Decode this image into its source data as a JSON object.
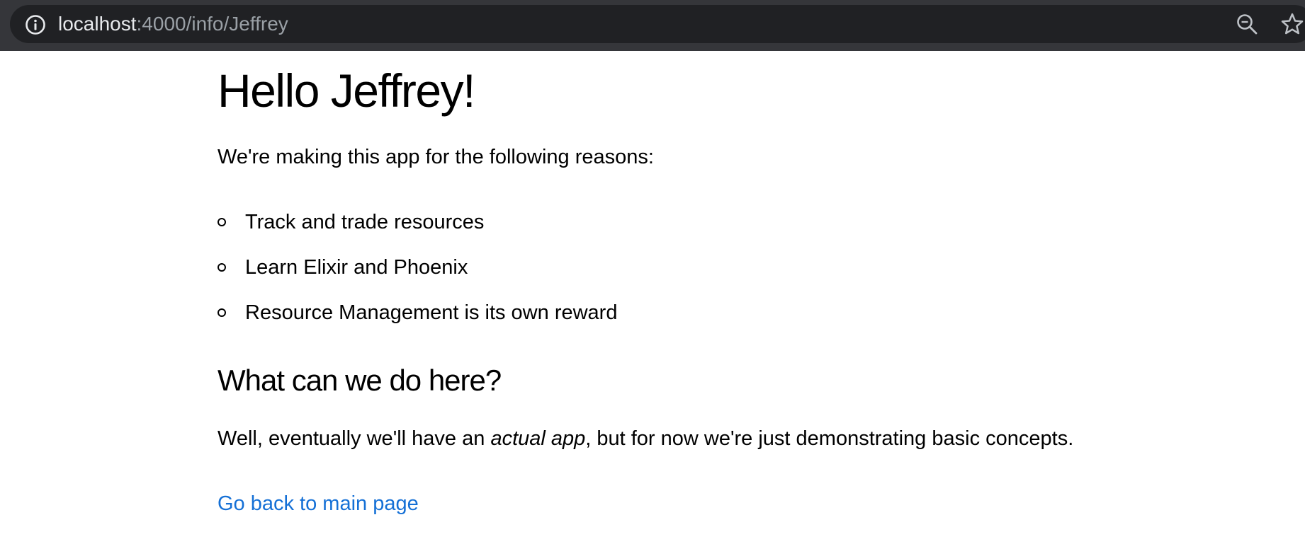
{
  "browser": {
    "url_host": "localhost",
    "url_rest": ":4000/info/Jeffrey",
    "icons": [
      "info-icon",
      "zoom-icon",
      "star-icon"
    ]
  },
  "page": {
    "title": "Hello Jeffrey!",
    "intro": "We're making this app for the following reasons:",
    "reasons": [
      "Track and trade resources",
      "Learn Elixir and Phoenix",
      "Resource Management is its own reward"
    ],
    "section_heading": "What can we do here?",
    "explanation": {
      "before": "Well, eventually we'll have an ",
      "emphasis": "actual app",
      "after": ", but for now we're just demonstrating basic concepts."
    },
    "back_link": "Go back to main page"
  },
  "colors": {
    "toolbar": "#35363a",
    "omnibox": "#202124",
    "link": "#1570d6"
  }
}
